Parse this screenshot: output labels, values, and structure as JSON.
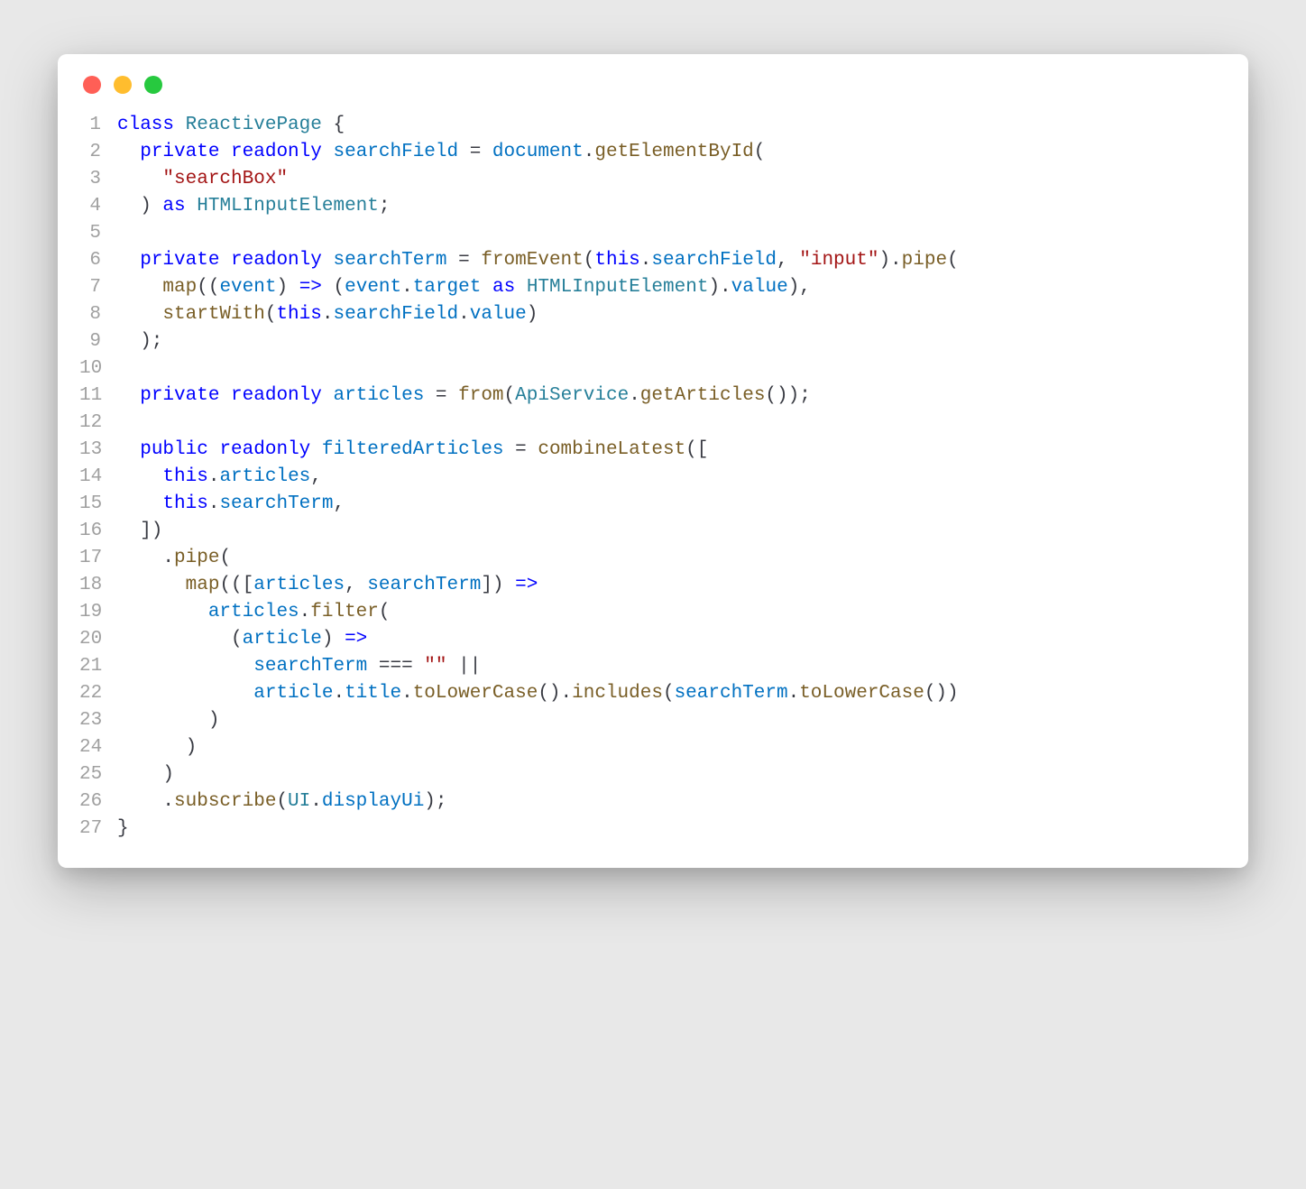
{
  "window": {
    "traffic": {
      "red": "#ff5f56",
      "yellow": "#ffbd2e",
      "green": "#27c93f"
    }
  },
  "code": {
    "lines": [
      {
        "n": "1",
        "tokens": [
          [
            "kw",
            "class"
          ],
          [
            "punc",
            " "
          ],
          [
            "type",
            "ReactivePage"
          ],
          [
            "punc",
            " {"
          ]
        ]
      },
      {
        "n": "2",
        "tokens": [
          [
            "punc",
            "  "
          ],
          [
            "kw",
            "private"
          ],
          [
            "punc",
            " "
          ],
          [
            "kw",
            "readonly"
          ],
          [
            "punc",
            " "
          ],
          [
            "prop",
            "searchField"
          ],
          [
            "punc",
            " = "
          ],
          [
            "prop",
            "document"
          ],
          [
            "punc",
            "."
          ],
          [
            "fn",
            "getElementById"
          ],
          [
            "punc",
            "("
          ]
        ]
      },
      {
        "n": "3",
        "tokens": [
          [
            "punc",
            "    "
          ],
          [
            "str",
            "\"searchBox\""
          ]
        ]
      },
      {
        "n": "4",
        "tokens": [
          [
            "punc",
            "  ) "
          ],
          [
            "kw",
            "as"
          ],
          [
            "punc",
            " "
          ],
          [
            "type",
            "HTMLInputElement"
          ],
          [
            "punc",
            ";"
          ]
        ]
      },
      {
        "n": "5",
        "tokens": []
      },
      {
        "n": "6",
        "tokens": [
          [
            "punc",
            "  "
          ],
          [
            "kw",
            "private"
          ],
          [
            "punc",
            " "
          ],
          [
            "kw",
            "readonly"
          ],
          [
            "punc",
            " "
          ],
          [
            "prop",
            "searchTerm"
          ],
          [
            "punc",
            " = "
          ],
          [
            "fn",
            "fromEvent"
          ],
          [
            "punc",
            "("
          ],
          [
            "kw",
            "this"
          ],
          [
            "punc",
            "."
          ],
          [
            "prop",
            "searchField"
          ],
          [
            "punc",
            ", "
          ],
          [
            "str",
            "\"input\""
          ],
          [
            "punc",
            ")."
          ],
          [
            "fn",
            "pipe"
          ],
          [
            "punc",
            "("
          ]
        ]
      },
      {
        "n": "7",
        "tokens": [
          [
            "punc",
            "    "
          ],
          [
            "fn",
            "map"
          ],
          [
            "punc",
            "(("
          ],
          [
            "param",
            "event"
          ],
          [
            "punc",
            ") "
          ],
          [
            "kw",
            "=>"
          ],
          [
            "punc",
            " ("
          ],
          [
            "prop",
            "event"
          ],
          [
            "punc",
            "."
          ],
          [
            "prop",
            "target"
          ],
          [
            "punc",
            " "
          ],
          [
            "kw",
            "as"
          ],
          [
            "punc",
            " "
          ],
          [
            "type",
            "HTMLInputElement"
          ],
          [
            "punc",
            ")."
          ],
          [
            "prop",
            "value"
          ],
          [
            "punc",
            "),"
          ]
        ]
      },
      {
        "n": "8",
        "tokens": [
          [
            "punc",
            "    "
          ],
          [
            "fn",
            "startWith"
          ],
          [
            "punc",
            "("
          ],
          [
            "kw",
            "this"
          ],
          [
            "punc",
            "."
          ],
          [
            "prop",
            "searchField"
          ],
          [
            "punc",
            "."
          ],
          [
            "prop",
            "value"
          ],
          [
            "punc",
            ")"
          ]
        ]
      },
      {
        "n": "9",
        "tokens": [
          [
            "punc",
            "  );"
          ]
        ]
      },
      {
        "n": "10",
        "tokens": []
      },
      {
        "n": "11",
        "tokens": [
          [
            "punc",
            "  "
          ],
          [
            "kw",
            "private"
          ],
          [
            "punc",
            " "
          ],
          [
            "kw",
            "readonly"
          ],
          [
            "punc",
            " "
          ],
          [
            "prop",
            "articles"
          ],
          [
            "punc",
            " = "
          ],
          [
            "fn",
            "from"
          ],
          [
            "punc",
            "("
          ],
          [
            "type",
            "ApiService"
          ],
          [
            "punc",
            "."
          ],
          [
            "fn",
            "getArticles"
          ],
          [
            "punc",
            "());"
          ]
        ]
      },
      {
        "n": "12",
        "tokens": []
      },
      {
        "n": "13",
        "tokens": [
          [
            "punc",
            "  "
          ],
          [
            "kw",
            "public"
          ],
          [
            "punc",
            " "
          ],
          [
            "kw",
            "readonly"
          ],
          [
            "punc",
            " "
          ],
          [
            "prop",
            "filteredArticles"
          ],
          [
            "punc",
            " = "
          ],
          [
            "fn",
            "combineLatest"
          ],
          [
            "punc",
            "(["
          ]
        ]
      },
      {
        "n": "14",
        "tokens": [
          [
            "punc",
            "    "
          ],
          [
            "kw",
            "this"
          ],
          [
            "punc",
            "."
          ],
          [
            "prop",
            "articles"
          ],
          [
            "punc",
            ","
          ]
        ]
      },
      {
        "n": "15",
        "tokens": [
          [
            "punc",
            "    "
          ],
          [
            "kw",
            "this"
          ],
          [
            "punc",
            "."
          ],
          [
            "prop",
            "searchTerm"
          ],
          [
            "punc",
            ","
          ]
        ]
      },
      {
        "n": "16",
        "tokens": [
          [
            "punc",
            "  ])"
          ]
        ]
      },
      {
        "n": "17",
        "tokens": [
          [
            "punc",
            "    ."
          ],
          [
            "fn",
            "pipe"
          ],
          [
            "punc",
            "("
          ]
        ]
      },
      {
        "n": "18",
        "tokens": [
          [
            "punc",
            "      "
          ],
          [
            "fn",
            "map"
          ],
          [
            "punc",
            "((["
          ],
          [
            "param",
            "articles"
          ],
          [
            "punc",
            ", "
          ],
          [
            "param",
            "searchTerm"
          ],
          [
            "punc",
            "]) "
          ],
          [
            "kw",
            "=>"
          ]
        ]
      },
      {
        "n": "19",
        "tokens": [
          [
            "punc",
            "        "
          ],
          [
            "prop",
            "articles"
          ],
          [
            "punc",
            "."
          ],
          [
            "fn",
            "filter"
          ],
          [
            "punc",
            "("
          ]
        ]
      },
      {
        "n": "20",
        "tokens": [
          [
            "punc",
            "          ("
          ],
          [
            "param",
            "article"
          ],
          [
            "punc",
            ") "
          ],
          [
            "kw",
            "=>"
          ]
        ]
      },
      {
        "n": "21",
        "tokens": [
          [
            "punc",
            "            "
          ],
          [
            "prop",
            "searchTerm"
          ],
          [
            "punc",
            " === "
          ],
          [
            "str",
            "\"\""
          ],
          [
            "punc",
            " ||"
          ]
        ]
      },
      {
        "n": "22",
        "tokens": [
          [
            "punc",
            "            "
          ],
          [
            "prop",
            "article"
          ],
          [
            "punc",
            "."
          ],
          [
            "prop",
            "title"
          ],
          [
            "punc",
            "."
          ],
          [
            "fn",
            "toLowerCase"
          ],
          [
            "punc",
            "()."
          ],
          [
            "fn",
            "includes"
          ],
          [
            "punc",
            "("
          ],
          [
            "prop",
            "searchTerm"
          ],
          [
            "punc",
            "."
          ],
          [
            "fn",
            "toLowerCase"
          ],
          [
            "punc",
            "())"
          ]
        ]
      },
      {
        "n": "23",
        "tokens": [
          [
            "punc",
            "        )"
          ]
        ]
      },
      {
        "n": "24",
        "tokens": [
          [
            "punc",
            "      )"
          ]
        ]
      },
      {
        "n": "25",
        "tokens": [
          [
            "punc",
            "    )"
          ]
        ]
      },
      {
        "n": "26",
        "tokens": [
          [
            "punc",
            "    ."
          ],
          [
            "fn",
            "subscribe"
          ],
          [
            "punc",
            "("
          ],
          [
            "type",
            "UI"
          ],
          [
            "punc",
            "."
          ],
          [
            "prop",
            "displayUi"
          ],
          [
            "punc",
            ");"
          ]
        ]
      },
      {
        "n": "27",
        "tokens": [
          [
            "punc",
            "}"
          ]
        ]
      }
    ]
  }
}
